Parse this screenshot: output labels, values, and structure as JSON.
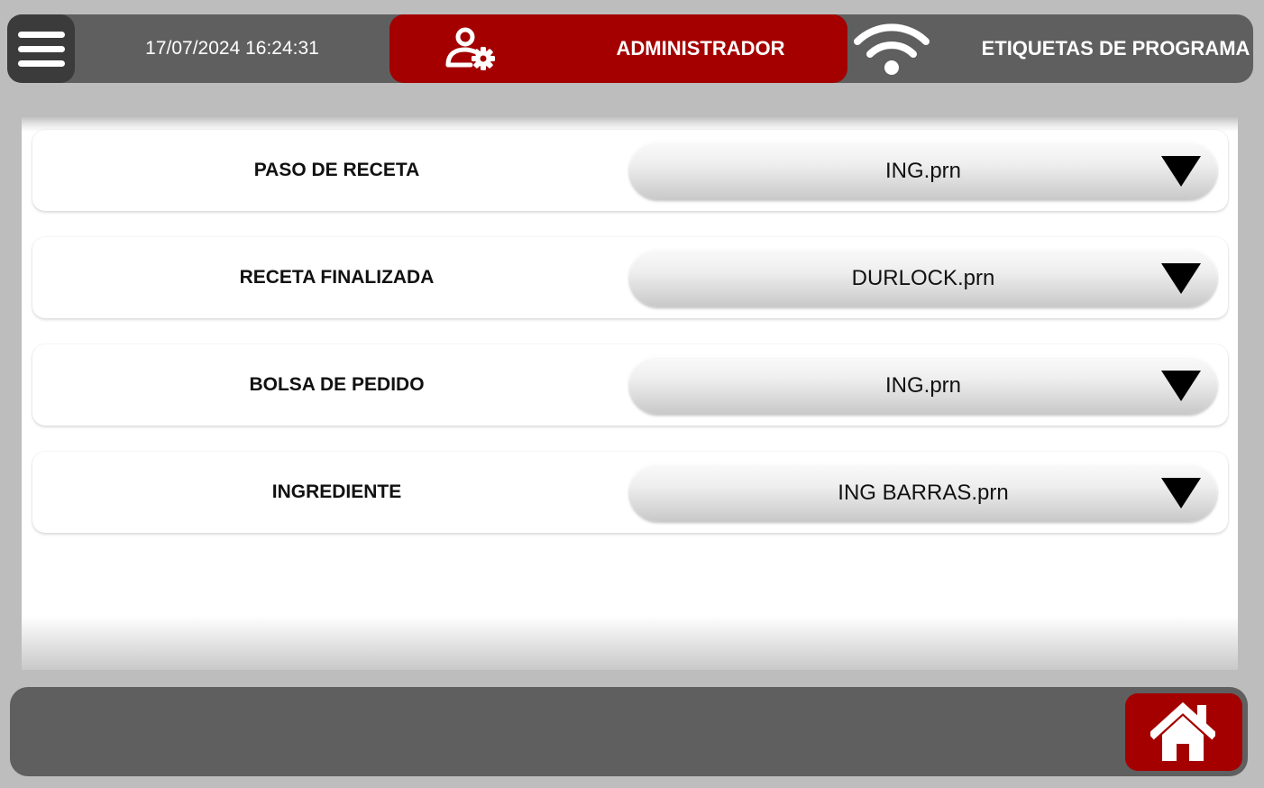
{
  "header": {
    "menu_icon": "hamburger-menu-icon",
    "datetime": "17/07/2024 16:24:31",
    "user_icon": "user-settings-icon",
    "user_role": "ADMINISTRADOR",
    "wifi_icon": "wifi-icon",
    "screen_title": "ETIQUETAS DE PROGRAMA"
  },
  "rows": [
    {
      "label": "PASO DE RECETA",
      "value": "ING.prn"
    },
    {
      "label": "RECETA FINALIZADA",
      "value": "DURLOCK.prn"
    },
    {
      "label": "BOLSA DE PEDIDO",
      "value": "ING.prn"
    },
    {
      "label": "INGREDIENTE",
      "value": "ING BARRAS.prn"
    }
  ],
  "footer": {
    "home_icon": "home-icon"
  },
  "colors": {
    "accent": "#a40000",
    "bar": "#5f5f5f",
    "background": "#bdbdbd"
  }
}
